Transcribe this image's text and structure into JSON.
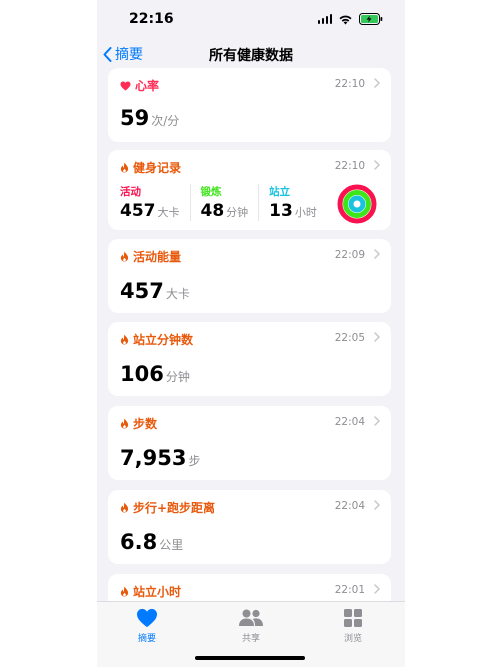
{
  "status": {
    "time": "22:16"
  },
  "nav": {
    "back_label": "摘要",
    "title": "所有健康数据"
  },
  "colors": {
    "accent": "#007aff",
    "heart": "#ff2d55",
    "fitness": "#e8590c",
    "move": "#fa114f",
    "exercise": "#3ee51a",
    "stand": "#19c3e0"
  },
  "cards": {
    "heart": {
      "title": "心率",
      "time": "22:10",
      "value": "59",
      "unit": "次/分",
      "icon": "heart-icon"
    },
    "workout": {
      "title": "健身记录",
      "time": "22:10",
      "icon": "flame-icon",
      "move": {
        "label": "活动",
        "value": "457",
        "unit": "大卡"
      },
      "exercise": {
        "label": "锻炼",
        "value": "48",
        "unit": "分钟"
      },
      "stand": {
        "label": "站立",
        "value": "13",
        "unit": "小时"
      }
    },
    "energy": {
      "title": "活动能量",
      "time": "22:09",
      "value": "457",
      "unit": "大卡",
      "icon": "flame-icon"
    },
    "stand_min": {
      "title": "站立分钟数",
      "time": "22:05",
      "value": "106",
      "unit": "分钟",
      "icon": "flame-icon"
    },
    "steps": {
      "title": "步数",
      "time": "22:04",
      "value": "7,953",
      "unit": "步",
      "icon": "flame-icon"
    },
    "distance": {
      "title": "步行+跑步距离",
      "time": "22:04",
      "value": "6.8",
      "unit": "公里",
      "icon": "flame-icon"
    },
    "stand_hours": {
      "title": "站立小时",
      "time": "22:01",
      "icon": "flame-icon"
    }
  },
  "tabbar": {
    "summary": {
      "label": "摘要",
      "icon": "heart-icon"
    },
    "sharing": {
      "label": "共享",
      "icon": "people-icon"
    },
    "browse": {
      "label": "浏览",
      "icon": "grid-icon"
    }
  }
}
